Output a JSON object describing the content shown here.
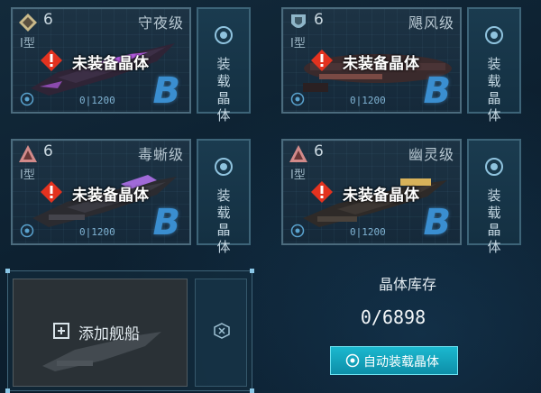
{
  "ships": [
    {
      "level": "6",
      "type_label": "Ⅰ型",
      "ship_class": "守夜级",
      "status": "未装备晶体",
      "exp": "0|1200",
      "grade": "B",
      "equip_label": "装载晶体",
      "badge_color": "#c9b98a",
      "hull_color": "#2f2436",
      "accent_color": "#b25be0"
    },
    {
      "level": "6",
      "type_label": "Ⅰ型",
      "ship_class": "飓风级",
      "status": "未装备晶体",
      "exp": "0|1200",
      "grade": "B",
      "equip_label": "装载晶体",
      "badge_color": "#8fb6c9",
      "hull_color": "#3a2a2c",
      "accent_color": "#7a4a44"
    },
    {
      "level": "6",
      "type_label": "Ⅰ型",
      "ship_class": "毒蜥级",
      "status": "未装备晶体",
      "exp": "0|1200",
      "grade": "B",
      "equip_label": "装载晶体",
      "badge_color": "#d28a8a",
      "hull_color": "#2b2b30",
      "accent_color": "#a06ad8"
    },
    {
      "level": "6",
      "type_label": "Ⅰ型",
      "ship_class": "幽灵级",
      "status": "未装备晶体",
      "exp": "0|1200",
      "grade": "B",
      "equip_label": "装载晶体",
      "badge_color": "#d28a8a",
      "hull_color": "#2e2a28",
      "accent_color": "#d8b25a"
    }
  ],
  "add_ship": {
    "label": "添加舰船"
  },
  "crystal_stock": {
    "title": "晶体库存",
    "count": "0/6898",
    "auto_button": "自动装载晶体"
  },
  "colors": {
    "warning": "#e3321f",
    "grade": "#3a8ed0",
    "auto_button": "#16a9c1"
  },
  "icons": {
    "warning": "warning-icon",
    "crystal_slot": "crystal-slot-icon",
    "close": "close-icon",
    "plus": "plus-icon"
  }
}
